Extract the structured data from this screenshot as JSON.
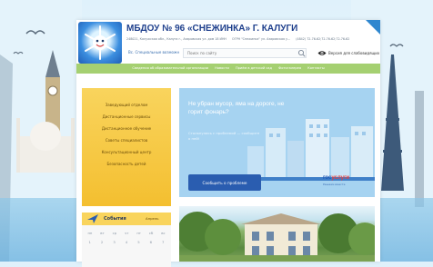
{
  "colors": {
    "title": "#1e3f8c",
    "nav": "#a5d071",
    "yellow": "#f4bf30",
    "banner": "#a6d3f1",
    "button": "#2a5db0",
    "corner": "#2f87cf"
  },
  "header": {
    "title": "МБДОУ № 96 «СНЕЖИНКА» Г. КАЛУГИ",
    "contacts": [
      "248021, Калужская обл., Калуга г., Азаровская ул. дом 18 ИНН",
      "ОГРН \"Снежинка\" ул. Азаровская у...",
      "(4842) 72-76-62;72-76-62;72-76-62"
    ],
    "vi_link": "Вс. Специальные возможн",
    "search_placeholder": "Поиск по сайту",
    "accessible_label": "Версия для слабовидящих",
    "icons": [
      "search-icon",
      "eye-icon"
    ]
  },
  "nav": {
    "items": [
      "Сведения об образовательной организации",
      "Новости",
      "Приём в детский сад",
      "Фотогалерея",
      "Контакты"
    ]
  },
  "sidebar": {
    "links": [
      "Заведующий отделом",
      "Дистанционные сервисы",
      "Дистанционное обучение",
      "Советы специалистов",
      "Консультационный центр",
      "Безопасность детей"
    ],
    "events_title": "События",
    "events_month": "Апрель",
    "weekdays": [
      "пн",
      "вт",
      "ср",
      "чт",
      "пт",
      "сб",
      "вс"
    ],
    "dates": [
      "1",
      "2",
      "3",
      "4",
      "5",
      "6",
      "7"
    ],
    "icons": [
      "plane-icon"
    ]
  },
  "banner": {
    "heading": "Не убран мусор, яма на дороге, не горит фонарь?",
    "subtitle": "Столкнулись с проблемой — сообщите о ней!",
    "button_label": "Сообщить о проблеме",
    "gos_logo_main": "гос",
    "gos_logo_accent": "услуги",
    "gos_sub": "Решаем вместе"
  }
}
